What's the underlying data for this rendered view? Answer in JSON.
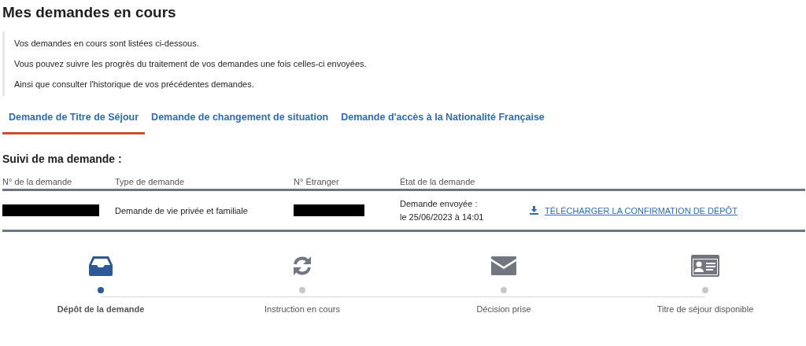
{
  "title": "Mes demandes en cours",
  "intro": [
    "Vos demandes en cours sont listées ci-dessous.",
    "Vous pouvez suivre les progrès du traitement de vos demandes une fois celles-ci envoyées.",
    "Ainsi que consulter l'historique de vos précédentes demandes."
  ],
  "tabs": [
    {
      "label": "Demande de Titre de Séjour",
      "selected": true
    },
    {
      "label": "Demande de changement de situation",
      "selected": false
    },
    {
      "label": "Demande d'accès à la Nationalité Française",
      "selected": false
    }
  ],
  "section_title": "Suivi de ma demande :",
  "table": {
    "columns": [
      "N° de la demande",
      "Type de demande",
      "N° Étranger",
      "État de la demande"
    ],
    "rows": [
      {
        "cells": [
          {
            "kind": "redacted"
          },
          {
            "kind": "text",
            "text": "Demande de vie privée et familiale"
          },
          {
            "kind": "redacted"
          },
          {
            "kind": "status",
            "lines": [
              "Demande envoyée :",
              "le 25/06/2023 à 14:01"
            ]
          }
        ],
        "link": "TÉLÉCHARGER LA CONFIRMATION DE DÉPÔT"
      }
    ]
  },
  "steps": [
    {
      "label": "Dépôt de la demande",
      "selected": true
    },
    {
      "label": "Instruction en cours",
      "selected": false
    },
    {
      "label": "Décision prise",
      "selected": false
    },
    {
      "label": "Titre de séjour disponible",
      "selected": false
    }
  ]
}
